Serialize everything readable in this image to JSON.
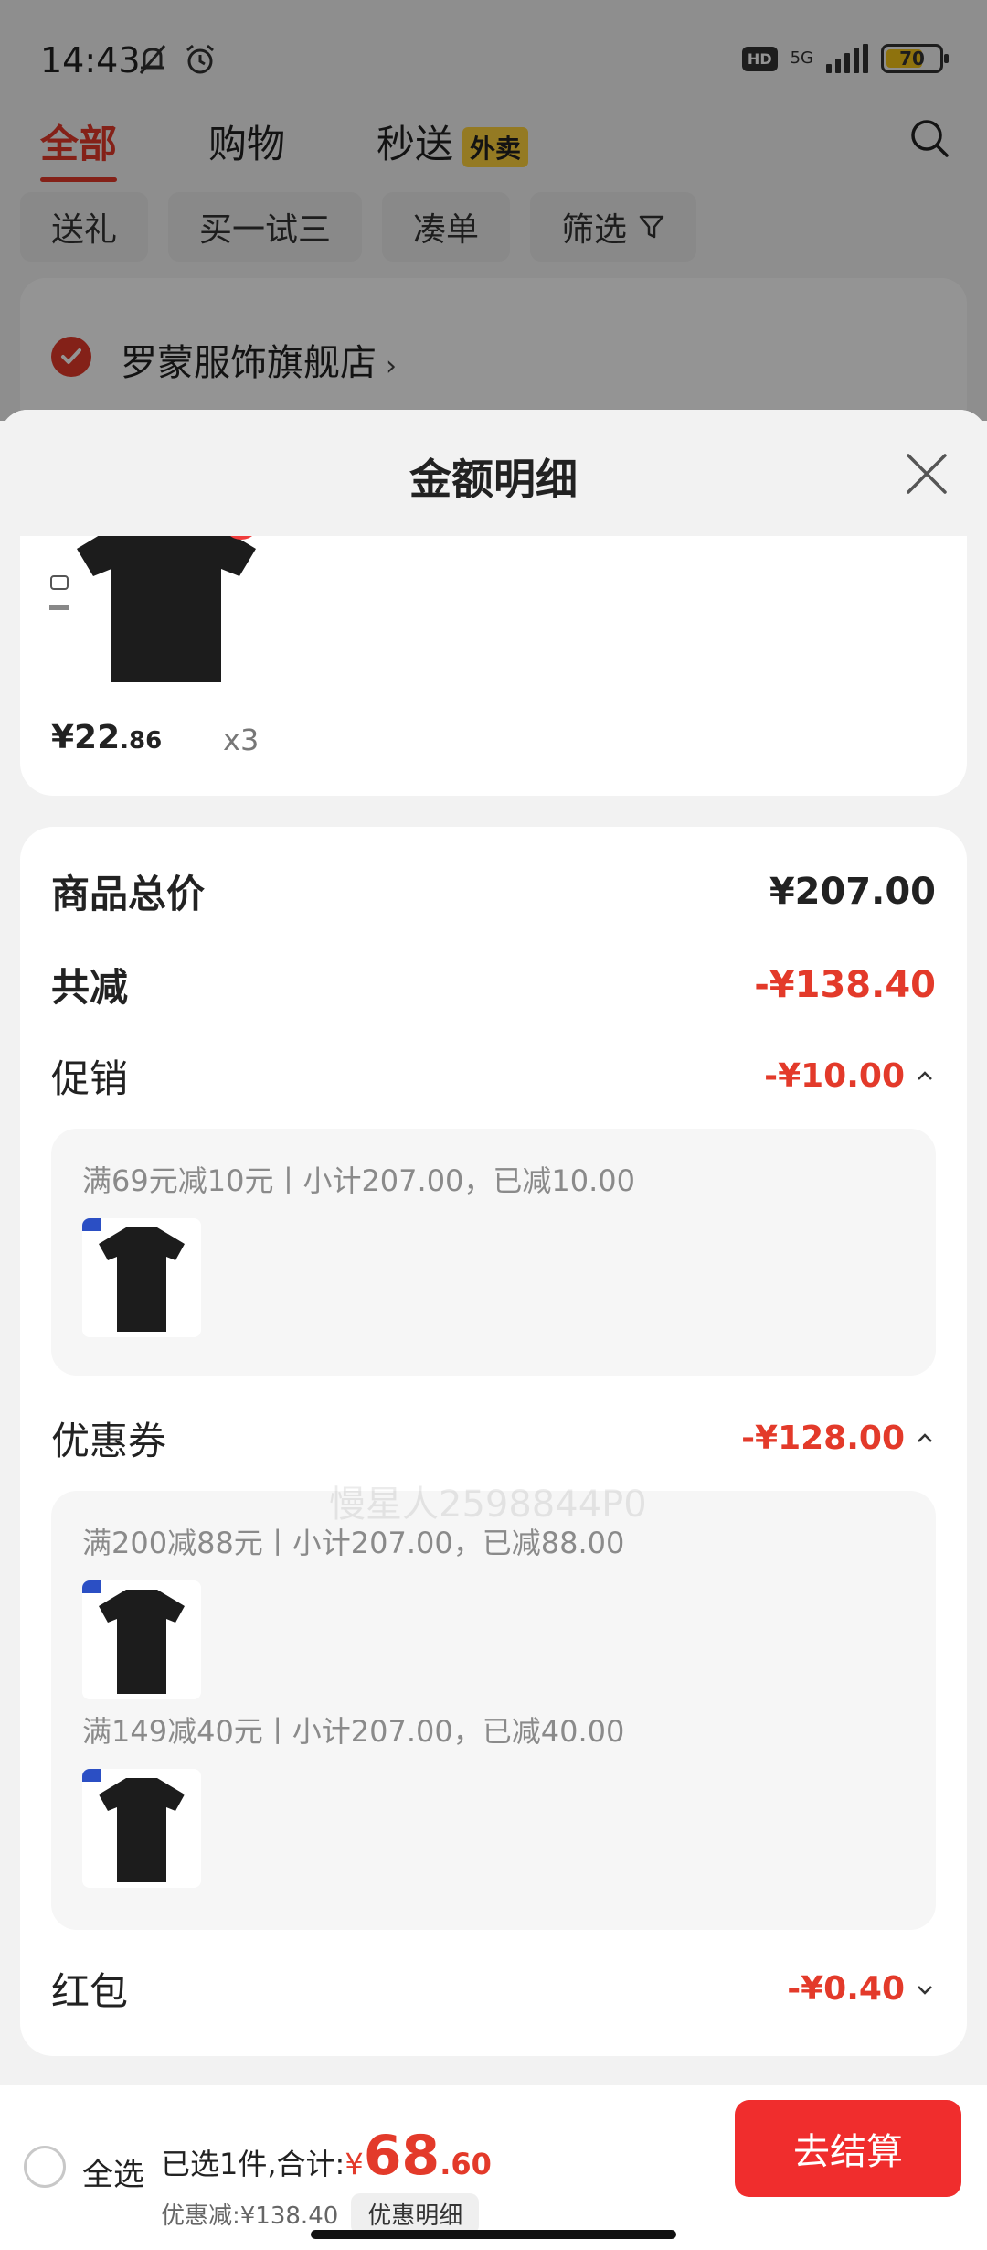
{
  "status_bar": {
    "time": "14:43",
    "hd_label": "HD",
    "network_label": "5G",
    "battery_level": "70",
    "battery_percent": 70
  },
  "nav": {
    "tabs": [
      {
        "label": "全部",
        "active": true
      },
      {
        "label": "购物",
        "active": false
      },
      {
        "label": "秒送",
        "active": false,
        "badge": "外卖"
      }
    ]
  },
  "filters": {
    "chips": [
      "送礼",
      "买一试三",
      "凑单",
      "筛选"
    ]
  },
  "store": {
    "name": "罗蒙服饰旗舰店"
  },
  "sheet": {
    "title": "金额明细",
    "product": {
      "price_main": "¥22",
      "price_decimal": ".86",
      "quantity": "x3"
    },
    "total_label": "商品总价",
    "total_value": "¥207.00",
    "reduction_label": "共减",
    "reduction_value": "-¥138.40",
    "promotion": {
      "label": "促销",
      "value": "-¥10.00",
      "lines": [
        "满69元减10元丨小计207.00，已减10.00"
      ]
    },
    "coupon": {
      "label": "优惠券",
      "value": "-¥128.00",
      "lines": [
        "满200减88元丨小计207.00，已减88.00",
        "满149减40元丨小计207.00，已减40.00"
      ]
    },
    "red_packet": {
      "label": "红包",
      "value": "-¥0.40"
    },
    "watermark": "慢星人2598844P0"
  },
  "bottom_bar": {
    "select_all_label": "全选",
    "selected_summary": "已选1件,合计:",
    "currency": "¥",
    "total_main": "68",
    "total_decimal": ".60",
    "discount_text": "优惠减:¥138.40",
    "discount_link": "优惠明细",
    "checkout_label": "去结算"
  },
  "colors": {
    "accent_red": "#e33a2a",
    "checkout_red": "#f02d2d",
    "badge_yellow": "#ffd23d"
  }
}
